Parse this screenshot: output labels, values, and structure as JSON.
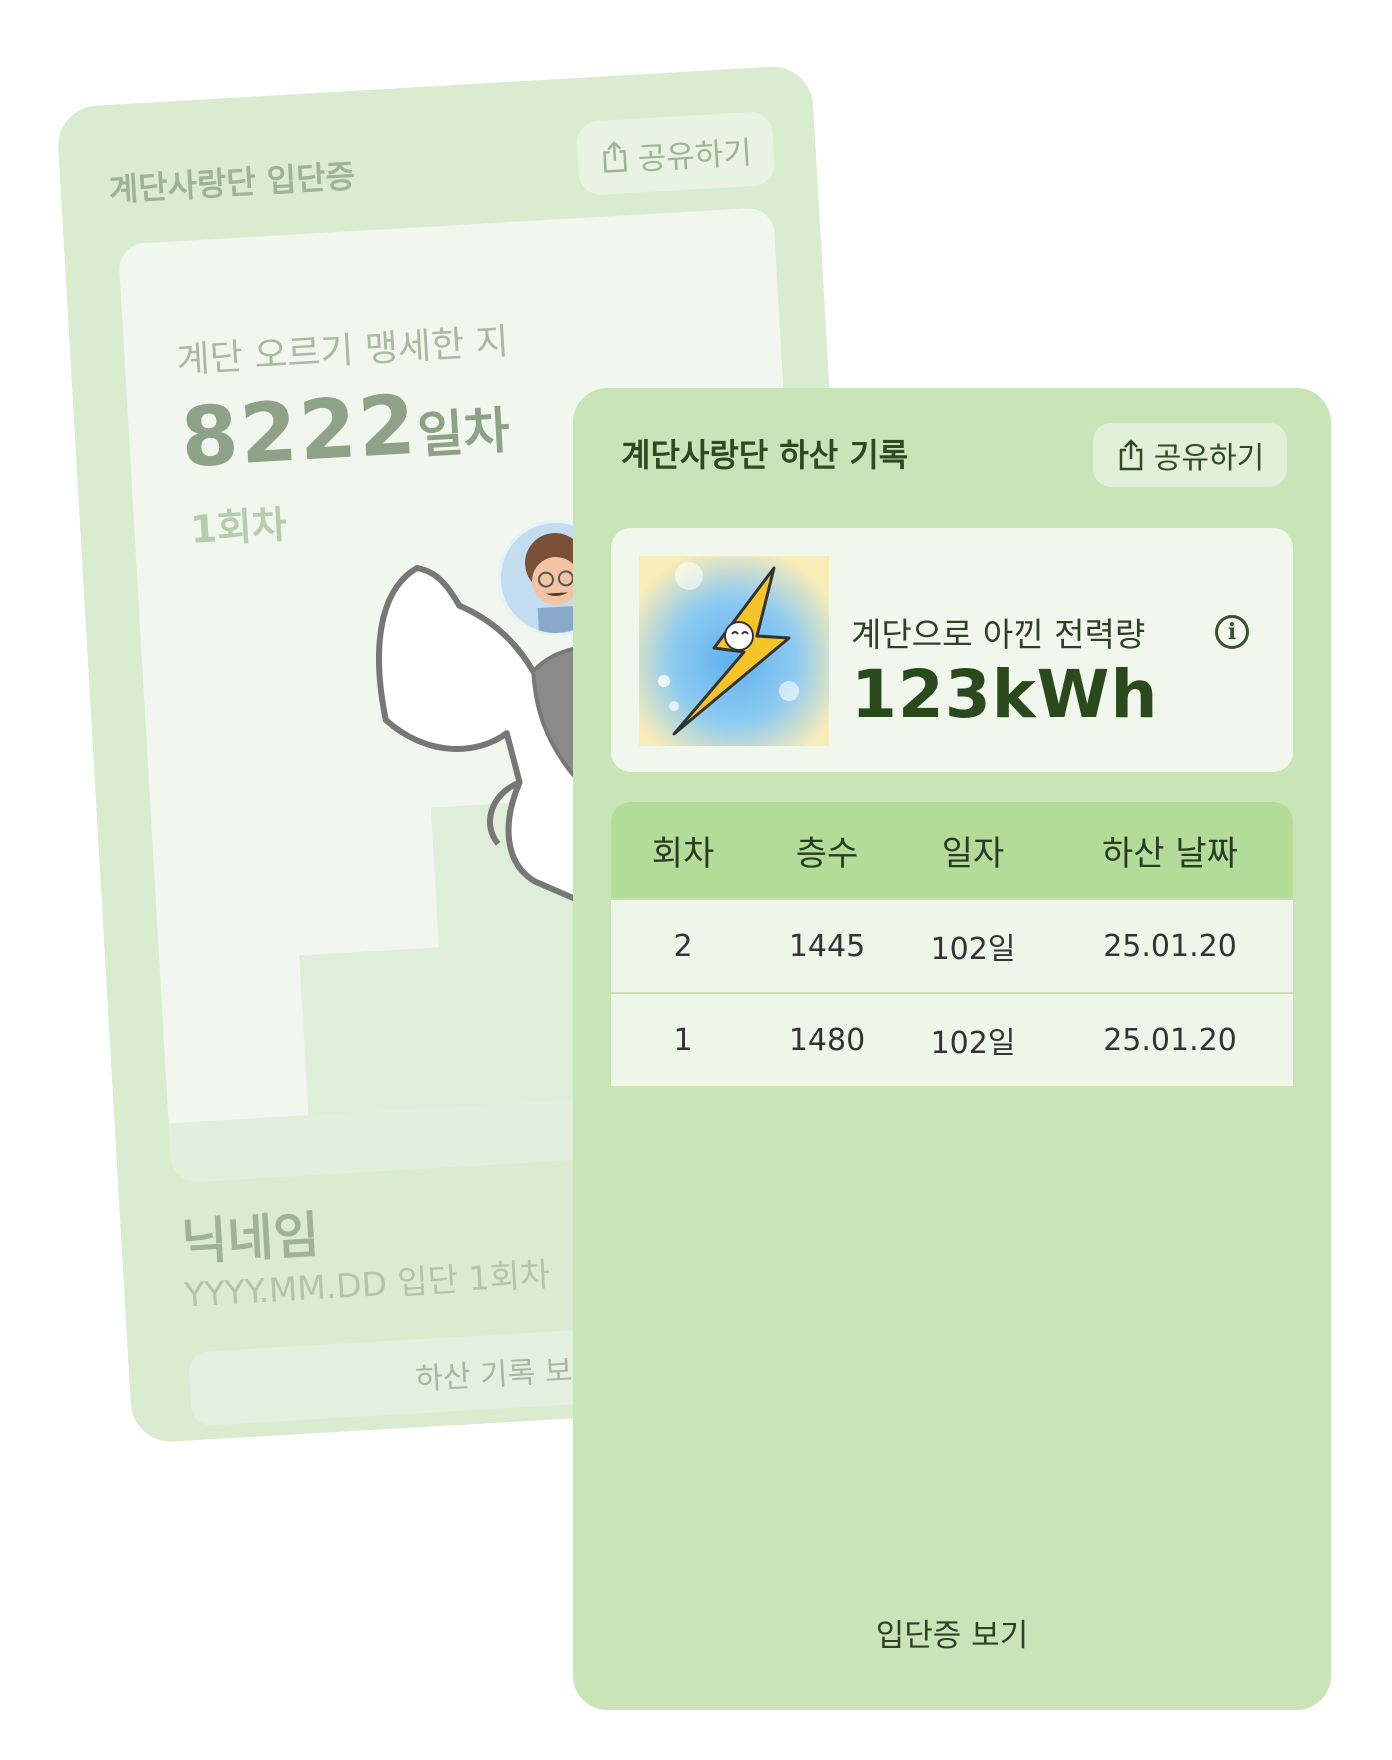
{
  "back_card": {
    "title": "계단사랑단 입단증",
    "share_label": "공유하기",
    "climb_label": "계단 오르기 맹세한 지",
    "days_number": "8222",
    "days_unit": "일차",
    "round_label": "1회차",
    "nickname": "닉네임",
    "join_date": "YYYY.MM.DD 입단 1회차",
    "descent_button": "하산 기록 보기"
  },
  "front_card": {
    "title": "계단사랑단 하산 기록",
    "share_label": "공유하기",
    "power": {
      "label": "계단으로 아낀 전력량",
      "value": "123kWh"
    },
    "table": {
      "headers": [
        "회차",
        "층수",
        "일자",
        "하산 날짜"
      ],
      "rows": [
        [
          "2",
          "1445",
          "102일",
          "25.01.20"
        ],
        [
          "1",
          "1480",
          "102일",
          "25.01.20"
        ]
      ]
    },
    "footer_link": "입단증 보기"
  },
  "icons": {
    "share": "share-icon",
    "info": "info-icon",
    "lightning": "lightning-icon"
  },
  "colors": {
    "front_bg": "#c9e5b8",
    "table_header": "#b3dc99",
    "back_bg": "#d9ecd0"
  }
}
